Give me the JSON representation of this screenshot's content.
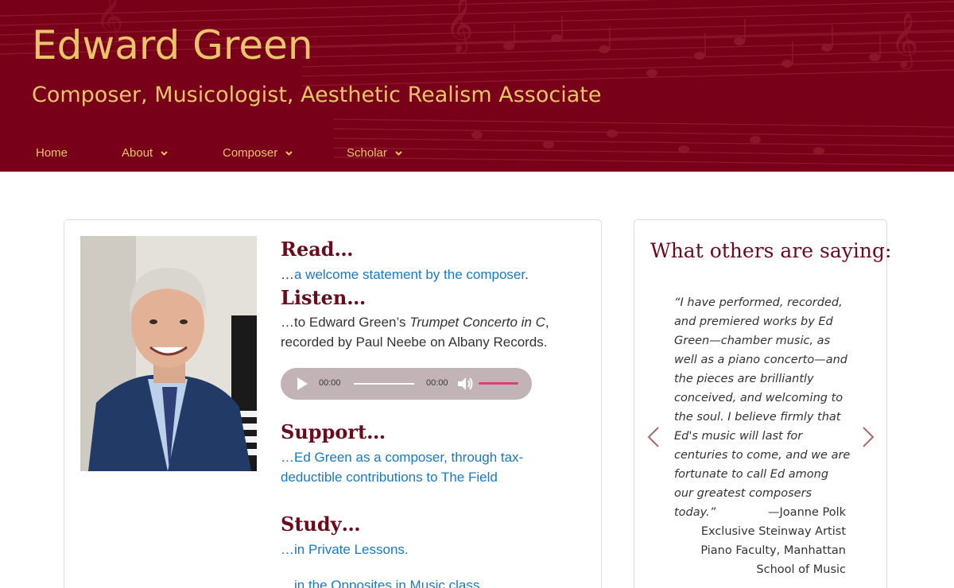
{
  "header": {
    "title": "Edward Green",
    "tagline": "Composer, Musicologist, Aesthetic Realism Associate",
    "background_color": "#780018",
    "text_color": "#e8c56a"
  },
  "nav": {
    "items": [
      {
        "label": "Home",
        "has_dropdown": false
      },
      {
        "label": "About",
        "has_dropdown": true
      },
      {
        "label": "Composer",
        "has_dropdown": true
      },
      {
        "label": "Scholar",
        "has_dropdown": true
      }
    ]
  },
  "main": {
    "photo_alt": "Edward Green",
    "read": {
      "heading": "Read…",
      "prefix": "…",
      "link": "a welcome statement by the composer",
      "suffix": "."
    },
    "listen": {
      "heading": "Listen…",
      "text_before": "…to Edward Green’s ",
      "work_title": "Trumpet Concerto in C",
      "text_after": ", recorded by Paul Neebe on Albany Records."
    },
    "audio": {
      "current_time": "00:00",
      "duration": "00:00",
      "play_icon": "play-icon",
      "volume_icon": "volume-icon",
      "volume_level": 1.0
    },
    "support": {
      "heading": "Support…",
      "link": "…Ed Green as a composer, through tax-deductible contributions to The Field"
    },
    "study": {
      "heading": "Study…",
      "link1": "…in Private Lessons.",
      "link2": "…in the Opposites in Music class."
    }
  },
  "sidebar": {
    "title": "What others are saying:",
    "quote": "“I have performed, recorded, and premiered works by Ed Green—chamber music, as well as a piano concerto—and the pieces are brilliantly conceived, and welcoming to the soul. I believe firmly that Ed's music will last for centuries to come, and we are fortunate to call Ed among our greatest composers today.”",
    "attribution_name": "—Joanne Polk",
    "attribution_line2": "Exclusive Steinway Artist",
    "attribution_line3": "Piano Faculty, Manhattan School of Music",
    "prev_icon": "chevron-left-icon",
    "next_icon": "chevron-right-icon"
  },
  "colors": {
    "heading": "#6a0a1c",
    "link": "#1a78c2",
    "body_text": "#333333",
    "audio_bg": "#c2b4b6",
    "volume_bar": "#d6427a"
  }
}
